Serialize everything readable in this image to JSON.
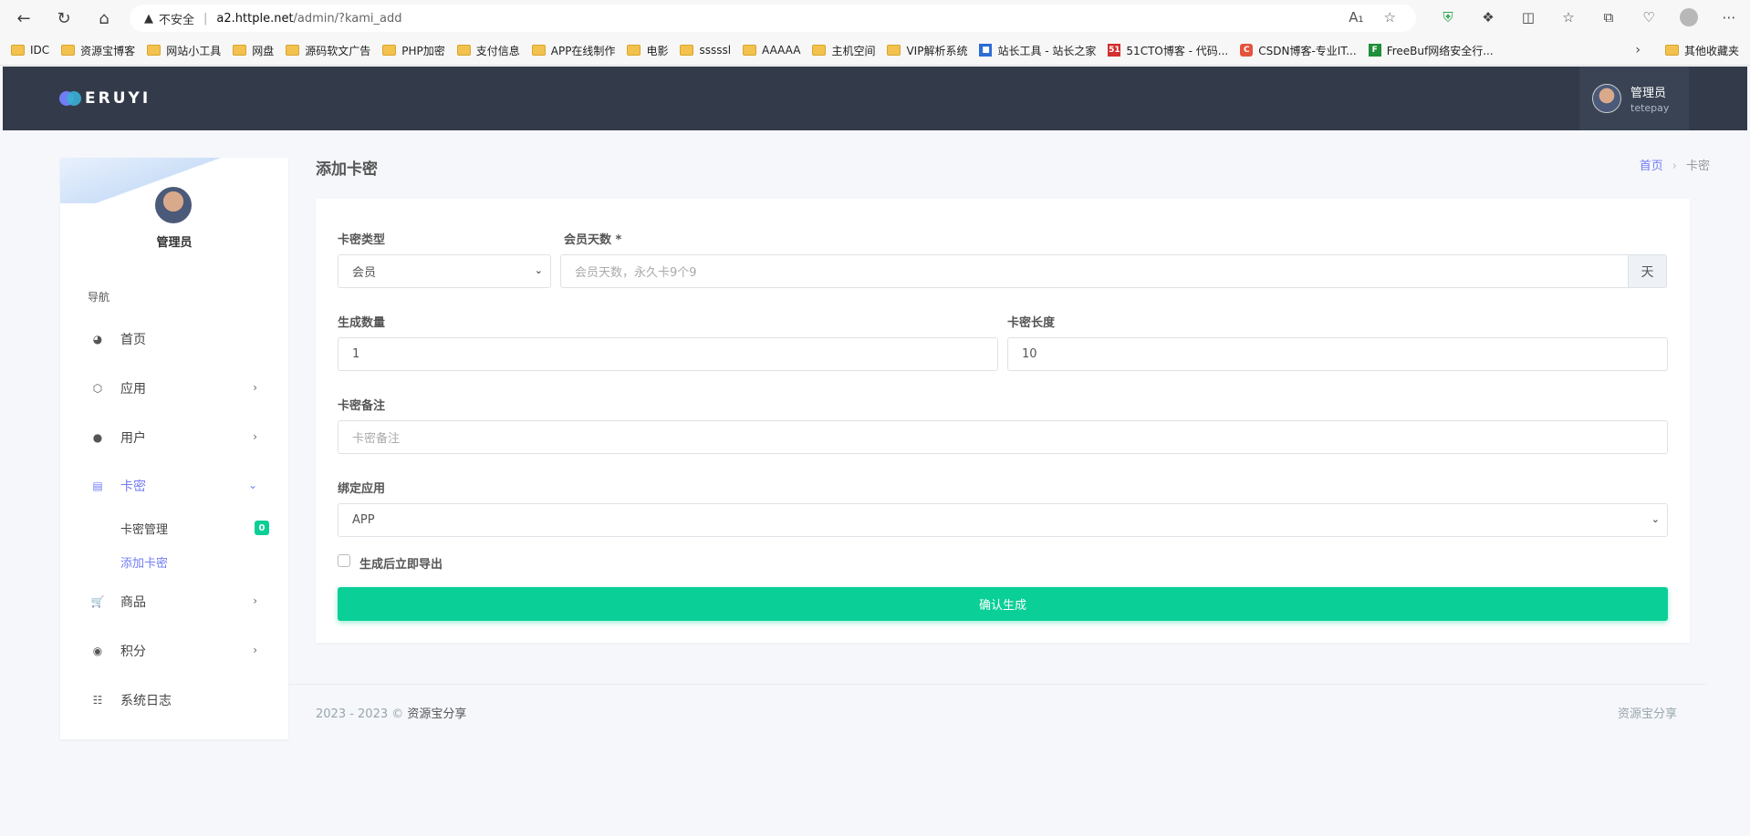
{
  "browser": {
    "url_warning": "不安全",
    "url_host": "a2.httple.net",
    "url_path": "/admin/?kami_add",
    "bookmarks": [
      "IDC",
      "资源宝博客",
      "网站小工具",
      "网盘",
      "源码软文广告",
      "PHP加密",
      "支付信息",
      "APP在线制作",
      "电影",
      "sssssl",
      "AAAAA",
      "主机空间",
      "VIP解析系统",
      "站长工具 - 站长之家",
      "51CTO博客 - 代码...",
      "CSDN博客-专业IT...",
      "FreeBuf网络安全行..."
    ],
    "other_bookmarks": "其他收藏夹"
  },
  "header": {
    "logo_text": "ERUYI",
    "user_name": "管理员",
    "user_sub": "tetepay"
  },
  "sidebar": {
    "user_name": "管理员",
    "nav_title": "导航",
    "items": [
      {
        "label": "首页"
      },
      {
        "label": "应用"
      },
      {
        "label": "用户"
      },
      {
        "label": "卡密"
      },
      {
        "label": "商品"
      },
      {
        "label": "积分"
      },
      {
        "label": "系统日志"
      }
    ],
    "sub_items": [
      {
        "label": "卡密管理",
        "badge": "0"
      },
      {
        "label": "添加卡密"
      }
    ]
  },
  "page": {
    "title": "添加卡密",
    "breadcrumb_home": "首页",
    "breadcrumb_current": "卡密"
  },
  "form": {
    "type_label": "卡密类型",
    "type_value": "会员",
    "days_label": "会员天数 *",
    "days_placeholder": "会员天数，永久卡9个9",
    "days_addon": "天",
    "count_label": "生成数量",
    "count_value": "1",
    "length_label": "卡密长度",
    "length_value": "10",
    "note_label": "卡密备注",
    "note_placeholder": "卡密备注",
    "app_label": "绑定应用",
    "app_value": "APP",
    "export_label": "生成后立即导出",
    "submit_label": "确认生成"
  },
  "footer": {
    "copyright": "2023 - 2023 ©",
    "brand": "资源宝分享",
    "right_text": "资源宝分享"
  }
}
